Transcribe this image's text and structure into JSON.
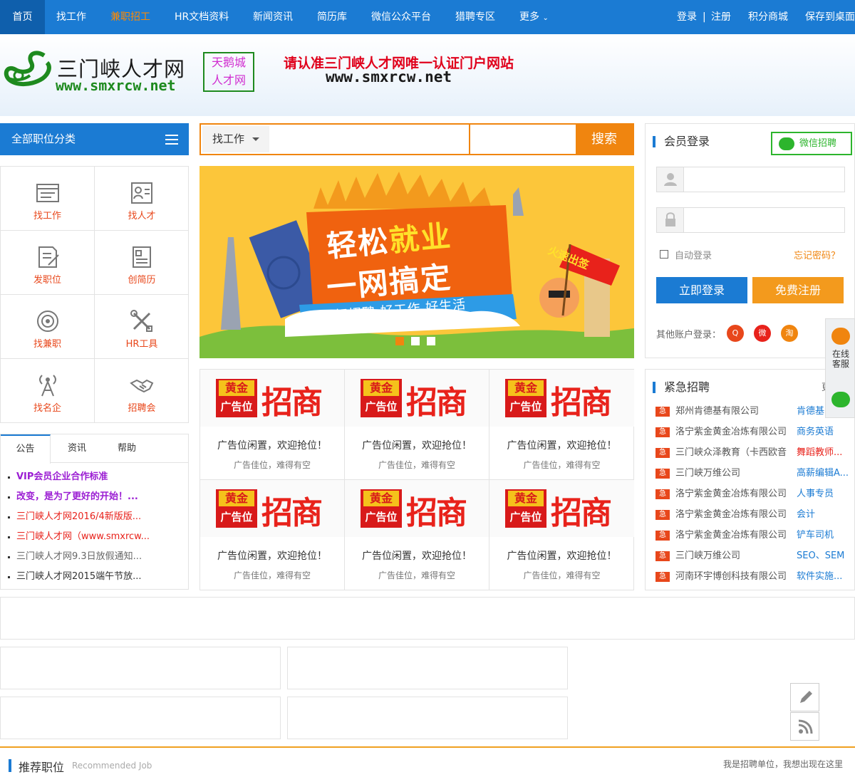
{
  "nav": {
    "items": [
      {
        "label": "首页"
      },
      {
        "label": "找工作"
      },
      {
        "label": "兼职招工"
      },
      {
        "label": "HR文档资料"
      },
      {
        "label": "新闻资讯"
      },
      {
        "label": "简历库"
      },
      {
        "label": "微信公众平台"
      },
      {
        "label": "猎聘专区"
      },
      {
        "label": "更多"
      }
    ],
    "login": "登录",
    "sep": "|",
    "register": "注册",
    "points": "积分商城",
    "save": "保存到桌面",
    "highlight_color": "#ff8a00",
    "bar_color": "#1b7bd3"
  },
  "header": {
    "logo_name": "三门峡人才网",
    "logo_url": "www.smxrcw.net",
    "badge_line1": "天鹅城",
    "badge_line2": "人才网",
    "slogan": "请认准三门峡人才网唯一认证门户网站",
    "slogan_url": "www.smxrcw.net"
  },
  "categories": {
    "title": "全部职位分类",
    "items": [
      {
        "label": "找工作",
        "icon": "job-list-icon"
      },
      {
        "label": "找人才",
        "icon": "resume-card-icon"
      },
      {
        "label": "发职位",
        "icon": "post-job-icon"
      },
      {
        "label": "创简历",
        "icon": "create-resume-icon"
      },
      {
        "label": "找兼职",
        "icon": "target-icon"
      },
      {
        "label": "HR工具",
        "icon": "tools-icon"
      },
      {
        "label": "找名企",
        "icon": "tower-icon"
      },
      {
        "label": "招聘会",
        "icon": "handshake-icon"
      }
    ]
  },
  "notice": {
    "tabs": [
      "公告",
      "资讯",
      "帮助"
    ],
    "items": [
      {
        "text": "VIP会员企业合作标准",
        "color": "#9b1dd3"
      },
      {
        "text": "改变，是为了更好的开始！...",
        "color": "#9b1dd3"
      },
      {
        "text": "三门峡人才网2016/4新版版...",
        "color": "#e8221b"
      },
      {
        "text": "三门峡人才网（www.smxrcw...",
        "color": "#e8221b"
      },
      {
        "text": "三门峡人才网9.3日放假通知...",
        "color": "#666666"
      },
      {
        "text": "三门峡人才网2015端午节放...",
        "color": "#333333"
      }
    ]
  },
  "search": {
    "type": "找工作",
    "button": "搜索"
  },
  "banner": {
    "line1a": "轻松",
    "line1b": "就业",
    "line2": "一网搞定",
    "line3": "好招聘  好工作  好生活",
    "flag": "火速出签"
  },
  "ads": {
    "gold_top": "黄金",
    "gold_bottom": "广告位",
    "big": "招商",
    "line1": "广告位闲置，欢迎抢位！",
    "line2": "广告佳位，难得有空"
  },
  "login": {
    "title": "会员登录",
    "wechat": "微信招聘",
    "auto": "自动登录",
    "forgot": "忘记密码？",
    "login_btn": "立即登录",
    "register_btn": "免费注册",
    "other": "其他账户登录：",
    "socials": [
      {
        "icon": "qq-icon",
        "glyph": "Q",
        "color": "#e8471b"
      },
      {
        "icon": "weibo-icon",
        "glyph": "微",
        "color": "#e8221b"
      },
      {
        "icon": "taobao-icon",
        "glyph": "淘",
        "color": "#f0850f"
      }
    ]
  },
  "urgent": {
    "title": "紧急招聘",
    "more": "更",
    "tag": "急",
    "items": [
      {
        "company": "郑州肯德基有限公司",
        "position": "肯德基"
      },
      {
        "company": "洛宁紫金黄金冶炼有限公司",
        "position": "商务英语"
      },
      {
        "company": "三门峡众泽教育（卡西欧音",
        "position": "舞蹈教师...",
        "hot": true
      },
      {
        "company": "三门峡万维公司",
        "position": "高薪编辑A..."
      },
      {
        "company": "洛宁紫金黄金冶炼有限公司",
        "position": "人事专员"
      },
      {
        "company": "洛宁紫金黄金冶炼有限公司",
        "position": "会计"
      },
      {
        "company": "洛宁紫金黄金冶炼有限公司",
        "position": "铲车司机"
      },
      {
        "company": "三门峡万维公司",
        "position": "SEO、SEM"
      },
      {
        "company": "河南环宇博创科技有限公司",
        "position": "软件实施..."
      }
    ]
  },
  "float": {
    "cs_line1": "在线",
    "cs_line2": "客服"
  },
  "recommend": {
    "title": "推荐职位",
    "en": "Recommended Job",
    "right": "我是招聘单位，我想出现在这里"
  }
}
